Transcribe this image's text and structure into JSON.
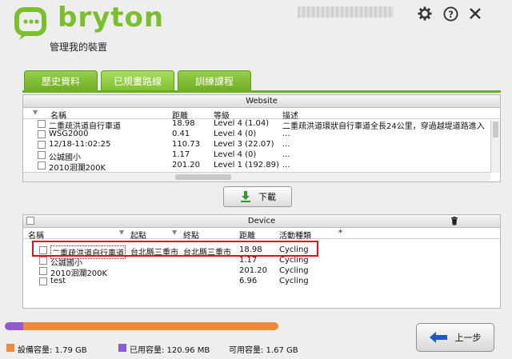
{
  "app": {
    "brand": "bryton",
    "subtitle": "管理我的裝置"
  },
  "tabs": [
    {
      "label": "歷史資料"
    },
    {
      "label": "已規畫路線"
    },
    {
      "label": "訓練課程"
    }
  ],
  "website": {
    "title": "Website",
    "columns": [
      "名稱",
      "距離",
      "等級",
      "描述"
    ],
    "rows": [
      {
        "name": "二重疏洪道自行車道",
        "distance": "18.98",
        "level": "Level 4 (1.04)",
        "desc": "二重疏洪道環狀自行車道全長24公里，穿過越堤道路進入"
      },
      {
        "name": "WSG2000",
        "distance": "0.41",
        "level": "Level 4 (0)",
        "desc": "..."
      },
      {
        "name": "12/18-11:02:25",
        "distance": "110.73",
        "level": "Level 3 (22.07)",
        "desc": "..."
      },
      {
        "name": "公誠國小",
        "distance": "1.17",
        "level": "Level 4 (0)",
        "desc": "..."
      },
      {
        "name": "2010洄瀾200K",
        "distance": "201.20",
        "level": "Level 1 (192.89)",
        "desc": "..."
      }
    ]
  },
  "download_label": "下載",
  "device": {
    "title": "Device",
    "columns": [
      "名稱",
      "起點",
      "終點",
      "距離",
      "活動種類",
      "*"
    ],
    "rows": [
      {
        "name": "二重疏洪道自行車道",
        "start": "台北縣三重市",
        "end": "台北縣三重市",
        "distance": "18.98",
        "type": "Cycling"
      },
      {
        "name": "公誠國小",
        "start": "",
        "end": "",
        "distance": "1.17",
        "type": "Cycling"
      },
      {
        "name": "2010洄瀾200K",
        "start": "",
        "end": "",
        "distance": "201.20",
        "type": "Cycling"
      },
      {
        "name": "test",
        "start": "",
        "end": "",
        "distance": "6.96",
        "type": "Cycling"
      }
    ]
  },
  "storage": {
    "device_label": "設備容量: 1.79 GB",
    "used_label": "已用容量: 120.96 MB",
    "free_label": "可用容量: 1.67 GB",
    "used_fraction": 0.066,
    "colors": {
      "device": "#f08a3a",
      "used": "#8e5bd0"
    }
  },
  "back_label": "上一步",
  "icons": [
    "gear-icon",
    "help-icon",
    "close-icon",
    "download-icon",
    "trash-icon",
    "back-arrow-icon"
  ]
}
